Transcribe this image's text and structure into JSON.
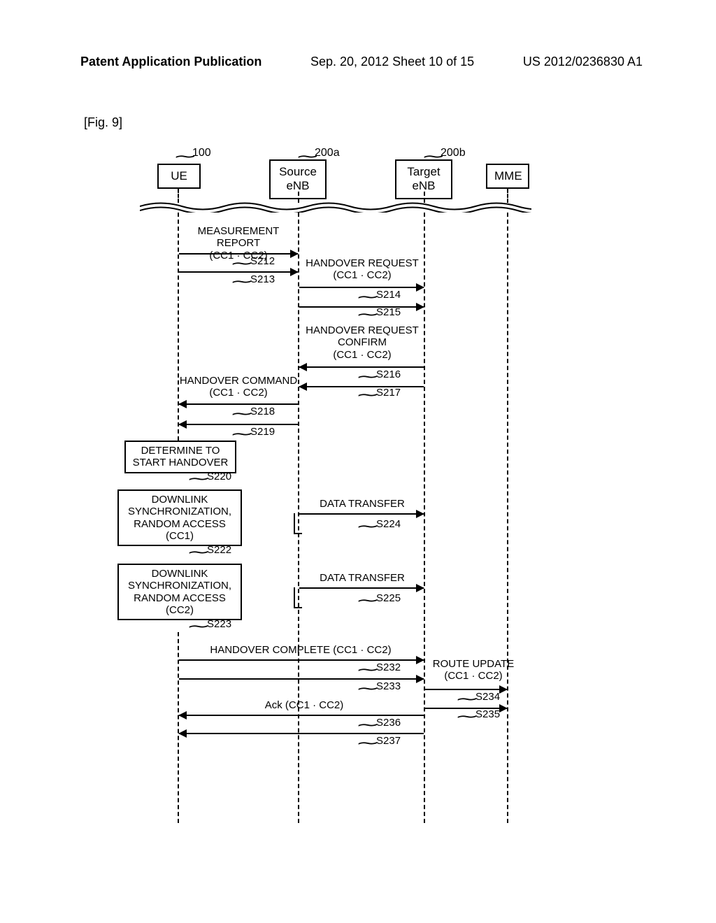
{
  "header": {
    "left": "Patent Application Publication",
    "center": "Sep. 20, 2012  Sheet 10 of 15",
    "right": "US 2012/0236830 A1"
  },
  "figure_label": "[Fig. 9]",
  "actors": {
    "ue": {
      "label": "UE",
      "ref": "100"
    },
    "source": {
      "label_line1": "Source",
      "label_line2": "eNB",
      "ref": "200a"
    },
    "target": {
      "label_line1": "Target",
      "label_line2": "eNB",
      "ref": "200b"
    },
    "mme": {
      "label": "MME"
    }
  },
  "messages": {
    "measurement_report": {
      "title": "MEASUREMENT REPORT",
      "sub": "(CC1 · CC2)"
    },
    "handover_request": {
      "title": "HANDOVER REQUEST",
      "sub": "(CC1 · CC2)"
    },
    "handover_request_confirm": {
      "title_l1": "HANDOVER REQUEST",
      "title_l2": "CONFIRM",
      "sub": "(CC1 · CC2)"
    },
    "handover_command": {
      "title": "HANDOVER COMMAND",
      "sub": "(CC1 · CC2)"
    },
    "data_transfer_1": {
      "title": "DATA TRANSFER"
    },
    "data_transfer_2": {
      "title": "DATA TRANSFER"
    },
    "handover_complete": {
      "title": "HANDOVER COMPLETE (CC1 · CC2)"
    },
    "route_update": {
      "title": "ROUTE UPDATE",
      "sub": "(CC1 · CC2)"
    },
    "ack": {
      "title": "Ack (CC1 · CC2)"
    }
  },
  "processes": {
    "determine": {
      "l1": "DETERMINE TO",
      "l2": "START HANDOVER"
    },
    "downlink1": {
      "l1": "DOWNLINK",
      "l2": "SYNCHRONIZATION,",
      "l3": "RANDOM ACCESS",
      "l4": "(CC1)"
    },
    "downlink2": {
      "l1": "DOWNLINK",
      "l2": "SYNCHRONIZATION,",
      "l3": "RANDOM ACCESS",
      "l4": "(CC2)"
    }
  },
  "steps": {
    "s212": "S212",
    "s213": "S213",
    "s214": "S214",
    "s215": "S215",
    "s216": "S216",
    "s217": "S217",
    "s218": "S218",
    "s219": "S219",
    "s220": "S220",
    "s222": "S222",
    "s223": "S223",
    "s224": "S224",
    "s225": "S225",
    "s232": "S232",
    "s233": "S233",
    "s234": "S234",
    "s235": "S235",
    "s236": "S236",
    "s237": "S237"
  },
  "chart_data": {
    "type": "sequence-diagram",
    "actors": [
      {
        "id": "UE",
        "label": "UE",
        "ref": "100"
      },
      {
        "id": "SourceENB",
        "label": "Source eNB",
        "ref": "200a"
      },
      {
        "id": "TargetENB",
        "label": "Target eNB",
        "ref": "200b"
      },
      {
        "id": "MME",
        "label": "MME"
      }
    ],
    "sequence": [
      {
        "step": "S212",
        "from": "UE",
        "to": "SourceENB",
        "message": "MEASUREMENT REPORT (CC1·CC2)"
      },
      {
        "step": "S213",
        "from": "UE",
        "to": "SourceENB",
        "message": "MEASUREMENT REPORT (CC1·CC2)"
      },
      {
        "step": "S214",
        "from": "SourceENB",
        "to": "TargetENB",
        "message": "HANDOVER REQUEST (CC1·CC2)"
      },
      {
        "step": "S215",
        "from": "SourceENB",
        "to": "TargetENB",
        "message": "HANDOVER REQUEST (CC1·CC2)"
      },
      {
        "step": "S216",
        "from": "TargetENB",
        "to": "SourceENB",
        "message": "HANDOVER REQUEST CONFIRM (CC1·CC2)"
      },
      {
        "step": "S217",
        "from": "TargetENB",
        "to": "SourceENB",
        "message": "HANDOVER REQUEST CONFIRM (CC1·CC2)"
      },
      {
        "step": "S218",
        "from": "SourceENB",
        "to": "UE",
        "message": "HANDOVER COMMAND (CC1·CC2)"
      },
      {
        "step": "S219",
        "from": "SourceENB",
        "to": "UE",
        "message": "HANDOVER COMMAND (CC1·CC2)"
      },
      {
        "step": "S220",
        "at": "UE",
        "process": "DETERMINE TO START HANDOVER"
      },
      {
        "step": "S222",
        "at": "UE",
        "process": "DOWNLINK SYNCHRONIZATION, RANDOM ACCESS (CC1)"
      },
      {
        "step": "S224",
        "from": "SourceENB",
        "to": "TargetENB",
        "message": "DATA TRANSFER"
      },
      {
        "step": "S223",
        "at": "UE",
        "process": "DOWNLINK SYNCHRONIZATION, RANDOM ACCESS (CC2)"
      },
      {
        "step": "S225",
        "from": "SourceENB",
        "to": "TargetENB",
        "message": "DATA TRANSFER"
      },
      {
        "step": "S232",
        "from": "UE",
        "to": "TargetENB",
        "message": "HANDOVER COMPLETE (CC1·CC2)"
      },
      {
        "step": "S233",
        "from": "UE",
        "to": "TargetENB",
        "message": "HANDOVER COMPLETE (CC1·CC2)"
      },
      {
        "step": "S234",
        "from": "TargetENB",
        "to": "MME",
        "message": "ROUTE UPDATE (CC1·CC2)"
      },
      {
        "step": "S235",
        "from": "TargetENB",
        "to": "MME",
        "message": "ROUTE UPDATE (CC1·CC2)"
      },
      {
        "step": "S236",
        "from": "TargetENB",
        "to": "UE",
        "message": "Ack (CC1·CC2)"
      },
      {
        "step": "S237",
        "from": "TargetENB",
        "to": "UE",
        "message": "Ack (CC1·CC2)"
      }
    ]
  }
}
